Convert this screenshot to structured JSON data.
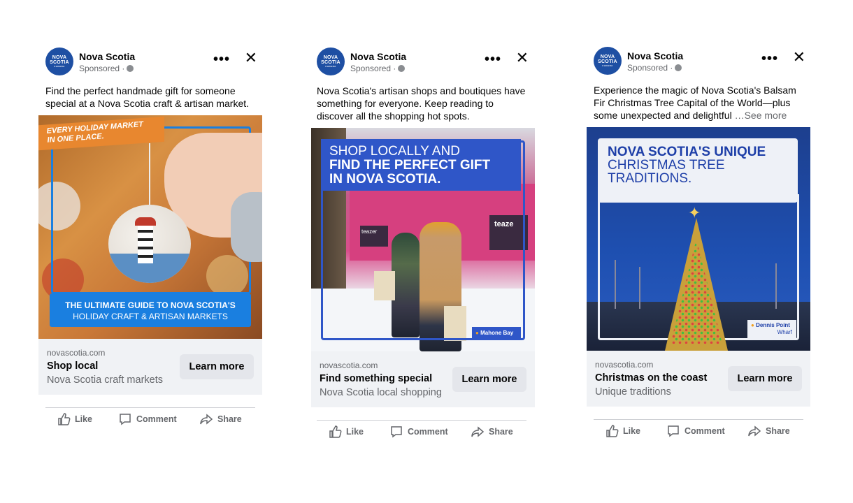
{
  "ads": [
    {
      "page_name": "Nova Scotia",
      "sponsored": "Sponsored ·",
      "text": "Find the perfect handmade gift for someone special at a Nova Scotia craft & artisan market.",
      "image": {
        "banner_line1": "EVERY HOLIDAY MARKET",
        "banner_line2": "IN ONE PLACE.",
        "caption_line1": "THE ULTIMATE GUIDE TO NOVA SCOTIA'S",
        "caption_line2": "HOLIDAY CRAFT & ARTISAN MARKETS"
      },
      "link": {
        "domain": "novascotia.com",
        "title": "Shop local",
        "subtitle": "Nova Scotia craft markets",
        "button": "Learn more"
      },
      "actions": {
        "like": "Like",
        "comment": "Comment",
        "share": "Share"
      }
    },
    {
      "page_name": "Nova Scotia",
      "sponsored": "Sponsored ·",
      "text": "Nova Scotia's artisan shops and boutiques have something for everyone. Keep reading to discover all the shopping hot spots.",
      "image": {
        "headline_line1": "SHOP LOCALLY AND",
        "headline_line2": "FIND THE PERFECT GIFT",
        "headline_line3": "IN NOVA SCOTIA.",
        "location": "Mahone Bay",
        "sign_left": "teazer",
        "sign_right": "teaze"
      },
      "link": {
        "domain": "novascotia.com",
        "title": "Find something special",
        "subtitle": "Nova Scotia local shopping",
        "button": "Learn more"
      },
      "actions": {
        "like": "Like",
        "comment": "Comment",
        "share": "Share"
      }
    },
    {
      "page_name": "Nova Scotia",
      "sponsored": "Sponsored ·",
      "text": "Experience the magic of Nova Scotia's Balsam Fir Christmas Tree Capital of the World—plus some unexpected and delightful",
      "see_more": "…See more",
      "image": {
        "headline_line1": "NOVA SCOTIA'S UNIQUE",
        "headline_line2": "CHRISTMAS TREE",
        "headline_line3": "TRADITIONS.",
        "location_line1": "Dennis Point",
        "location_line2": "Wharf"
      },
      "link": {
        "domain": "novascotia.com",
        "title": "Christmas on the coast",
        "subtitle": "Unique traditions",
        "button": "Learn more"
      },
      "actions": {
        "like": "Like",
        "comment": "Comment",
        "share": "Share"
      }
    }
  ],
  "logo": {
    "line1": "NOVA",
    "line2": "SCOTIA",
    "line3": "CANADA"
  },
  "colors": {
    "brand_blue": "#1e4fa3",
    "accent_orange": "#e8872f",
    "caption_blue": "#1a7fe0",
    "link_bg": "#f0f2f5",
    "button_bg": "#e4e6eb"
  },
  "icons": [
    "more-options-icon",
    "close-icon",
    "globe-icon",
    "like-icon",
    "comment-icon",
    "share-icon",
    "location-pin-icon"
  ]
}
